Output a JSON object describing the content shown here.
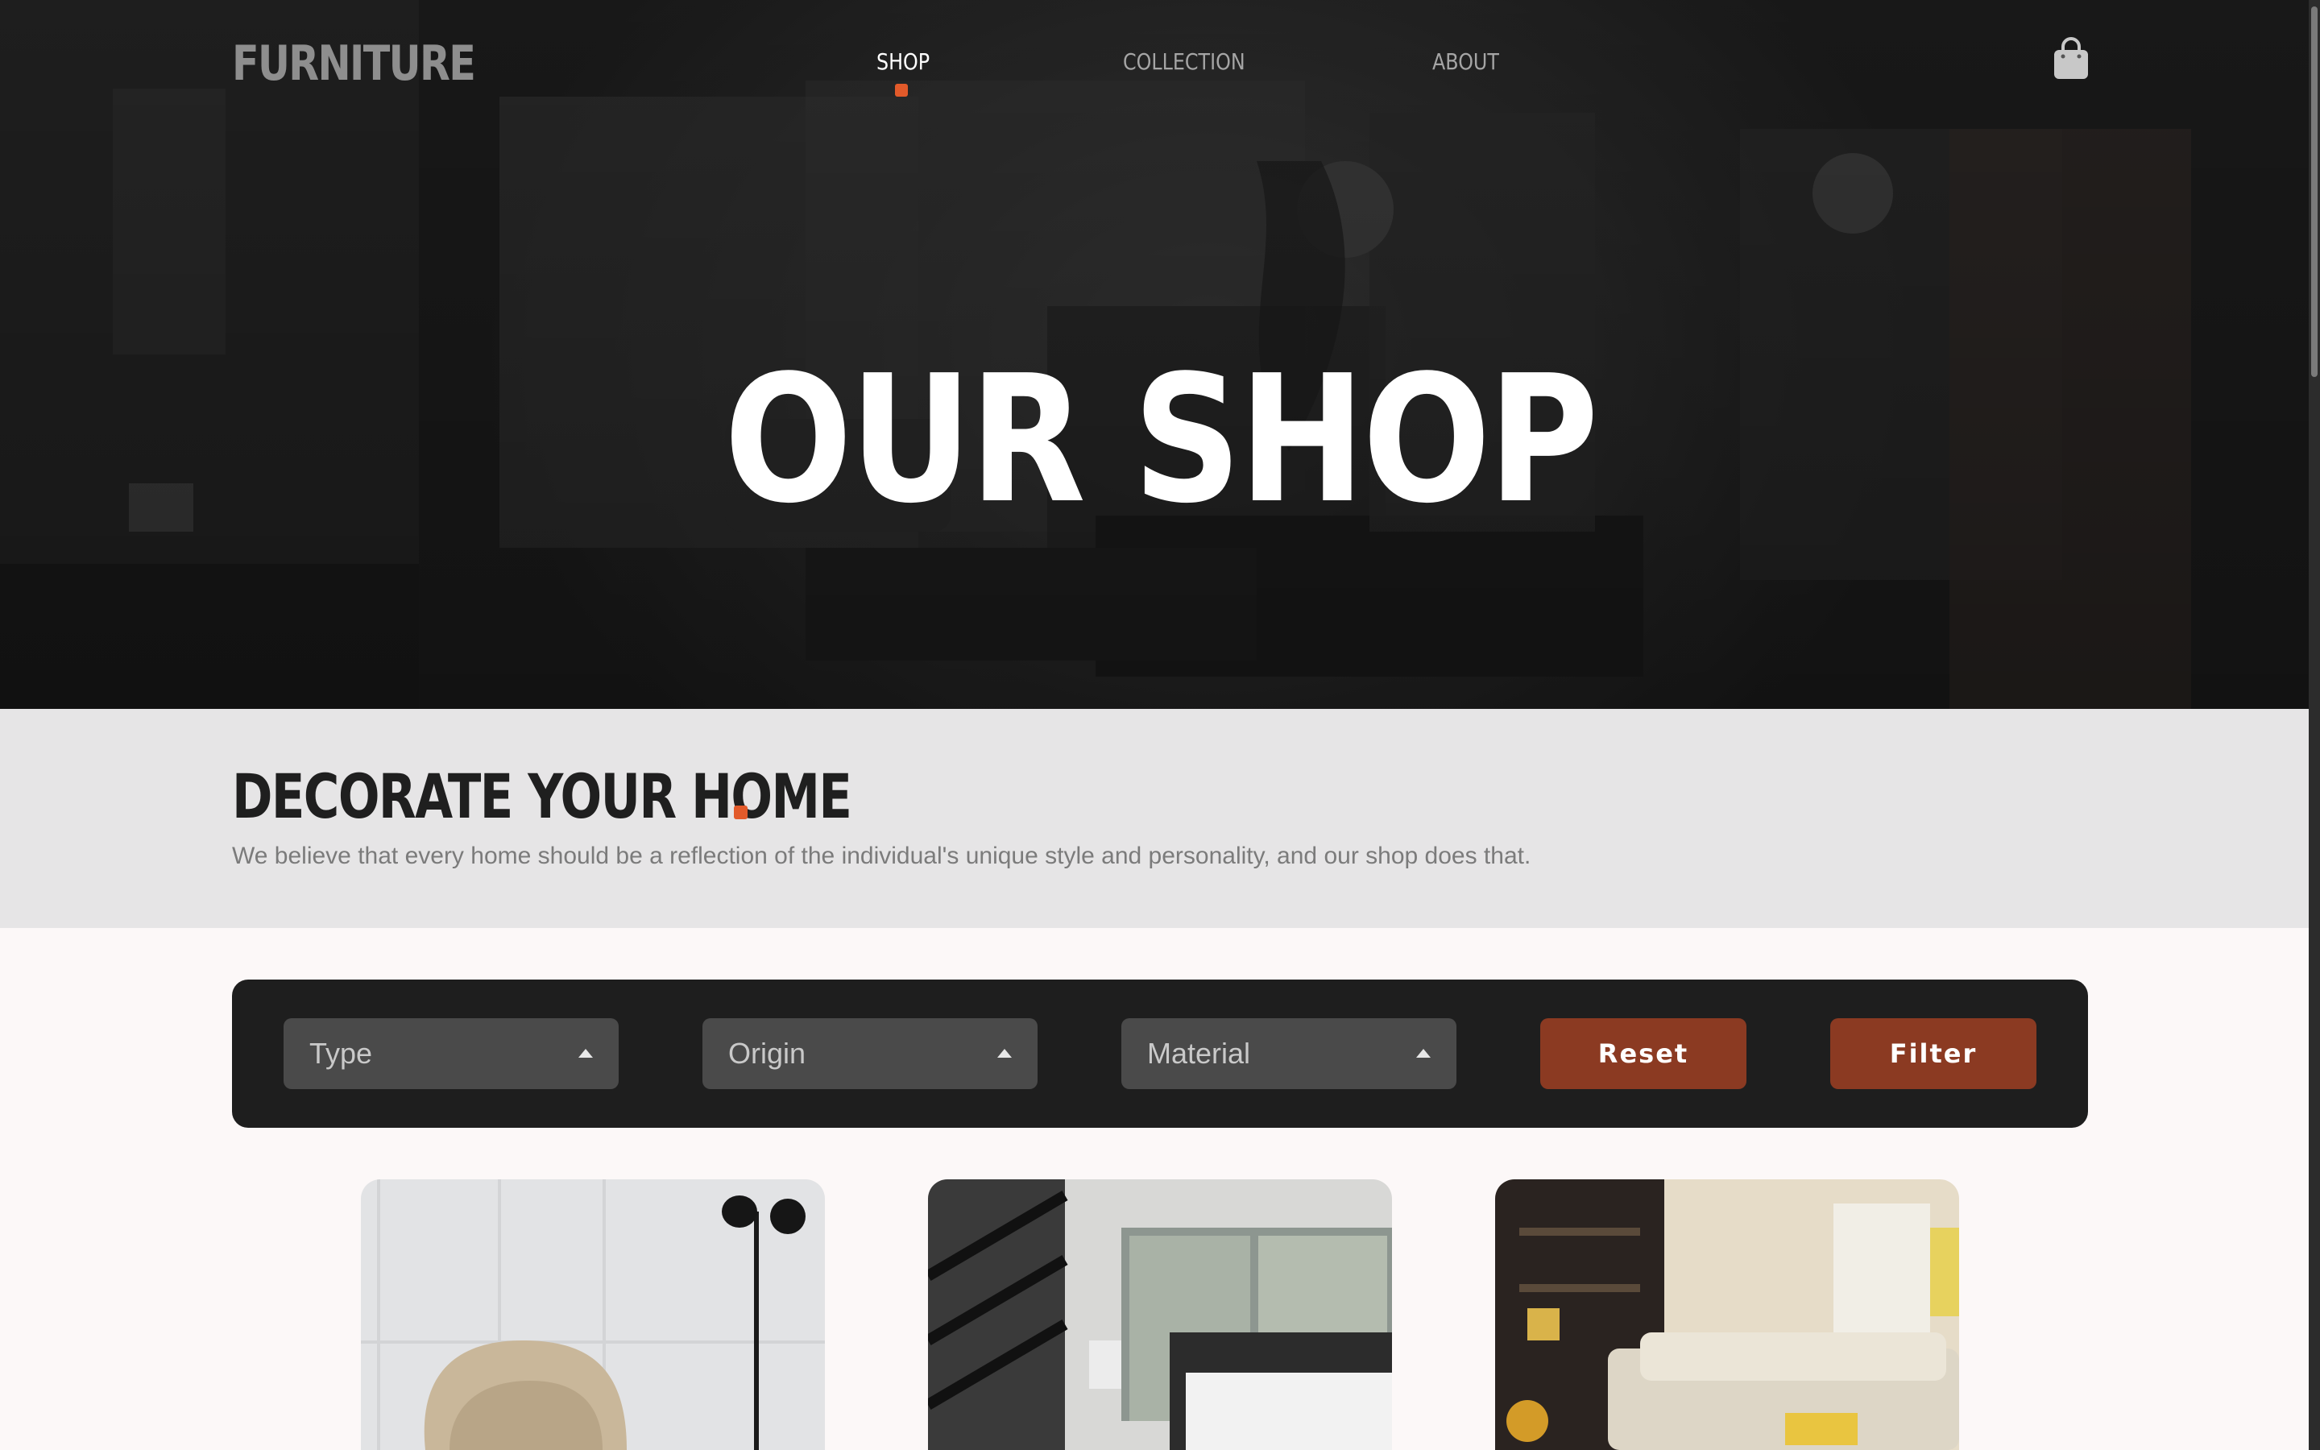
{
  "header": {
    "brand": "FURNITURE",
    "nav": [
      {
        "label": "SHOP",
        "active": true
      },
      {
        "label": "COLLECTION",
        "active": false
      },
      {
        "label": "ABOUT",
        "active": false
      }
    ],
    "cart_icon": "shopping-bag-icon"
  },
  "hero": {
    "title": "OUR SHOP"
  },
  "intro": {
    "title": "DECORATE YOUR HOME",
    "text": "We believe that every home should be a reflection of the individual's unique style and personality, and our shop does that."
  },
  "filters": {
    "type_placeholder": "Type",
    "origin_placeholder": "Origin",
    "material_placeholder": "Material",
    "reset_label": "Reset",
    "filter_label": "Filter"
  },
  "products": [
    {
      "image": "beige armchair with floor lamp"
    },
    {
      "image": "bedroom with staircase"
    },
    {
      "image": "living room sectional sofa"
    }
  ],
  "colors": {
    "accent": "#e25a2a",
    "button": "#8b3a22",
    "filter_bar": "#1e1e1e",
    "intro_band": "#e6e5e6",
    "page_bg": "#fcf8f8"
  }
}
